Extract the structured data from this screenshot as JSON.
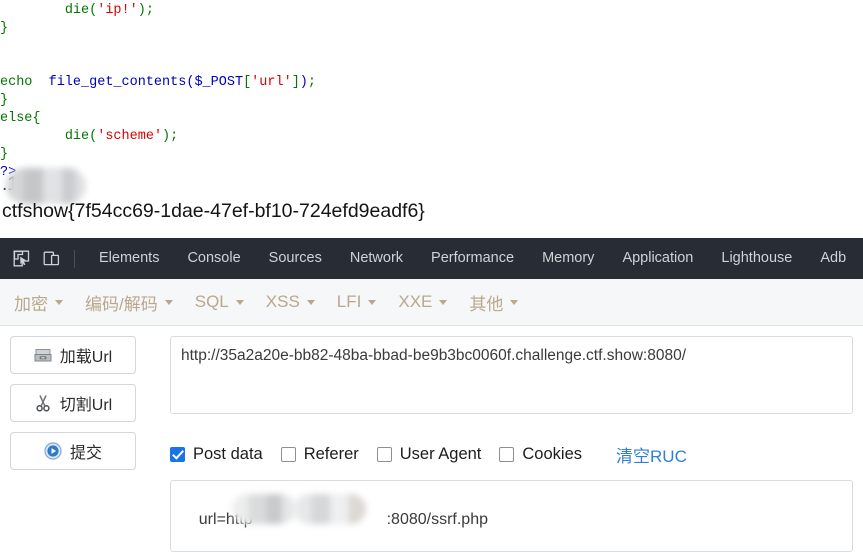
{
  "code_output": {
    "lines": [
      {
        "indent": 8,
        "tokens": [
          {
            "t": "die",
            "c": "kw"
          },
          {
            "t": "(",
            "c": "punc"
          },
          {
            "t": "'ip!'",
            "c": "str"
          },
          {
            "t": ")",
            "c": "punc"
          },
          {
            "t": ";",
            "c": "punc"
          }
        ]
      },
      {
        "indent": 0,
        "tokens": [
          {
            "t": "}",
            "c": "punc"
          }
        ]
      },
      {
        "indent": 0,
        "tokens": []
      },
      {
        "indent": 0,
        "tokens": []
      },
      {
        "indent": 0,
        "tokens": [
          {
            "t": "echo",
            "c": "kw"
          },
          {
            "t": "  ",
            "c": "plain"
          },
          {
            "t": "file_get_contents",
            "c": "fn"
          },
          {
            "t": "(",
            "c": "fn"
          },
          {
            "t": "$_POST",
            "c": "var"
          },
          {
            "t": "[",
            "c": "punc"
          },
          {
            "t": "'url'",
            "c": "str"
          },
          {
            "t": "]",
            "c": "punc"
          },
          {
            "t": ")",
            "c": "fn"
          },
          {
            "t": ";",
            "c": "punc"
          }
        ]
      },
      {
        "indent": 0,
        "tokens": [
          {
            "t": "}",
            "c": "punc"
          }
        ]
      },
      {
        "indent": 0,
        "tokens": [
          {
            "t": "else",
            "c": "kw"
          },
          {
            "t": "{",
            "c": "punc"
          }
        ]
      },
      {
        "indent": 8,
        "tokens": [
          {
            "t": "die",
            "c": "kw"
          },
          {
            "t": "(",
            "c": "punc"
          },
          {
            "t": "'scheme'",
            "c": "str"
          },
          {
            "t": ")",
            "c": "punc"
          },
          {
            "t": ";",
            "c": "punc"
          }
        ]
      },
      {
        "indent": 0,
        "tokens": [
          {
            "t": "}",
            "c": "punc"
          }
        ]
      },
      {
        "indent": 0,
        "tokens": [
          {
            "t": "?>",
            "c": "tag"
          }
        ]
      }
    ],
    "ip_line": ".141",
    "flag_line": "ctfshow{7f54cc69-1dae-47ef-bf10-724efd9eadf6}"
  },
  "devtools": {
    "inspect_icon": "inspect-element-icon",
    "device_icon": "device-toolbar-icon",
    "tabs": [
      {
        "label": "Elements"
      },
      {
        "label": "Console"
      },
      {
        "label": "Sources"
      },
      {
        "label": "Network"
      },
      {
        "label": "Performance"
      },
      {
        "label": "Memory"
      },
      {
        "label": "Application"
      },
      {
        "label": "Lighthouse"
      },
      {
        "label": "Adb"
      }
    ]
  },
  "tool_menubar": {
    "items": [
      {
        "label": "加密"
      },
      {
        "label": "编码/解码"
      },
      {
        "label": "SQL"
      },
      {
        "label": "XSS"
      },
      {
        "label": "LFI"
      },
      {
        "label": "XXE"
      },
      {
        "label": "其他"
      }
    ]
  },
  "workspace": {
    "buttons": [
      {
        "label": "加载Url",
        "icon": "load-url-icon"
      },
      {
        "label": "切割Url",
        "icon": "scissors-icon"
      },
      {
        "label": "提交",
        "icon": "play-circle-icon"
      }
    ],
    "url_field": {
      "value": "http://35a2a20e-bb82-48ba-bbad-be9b3bc0060f.challenge.ctf.show:8080/",
      "placeholder": ""
    },
    "options": [
      {
        "label": "Post data",
        "checked": true
      },
      {
        "label": "Referer",
        "checked": false
      },
      {
        "label": "User Agent",
        "checked": false
      },
      {
        "label": "Cookies",
        "checked": false
      }
    ],
    "clear_link": "清空RUC",
    "postdata_field": {
      "prefix": "url=http",
      "suffix": ":8080/ssrf.php",
      "placeholder": ""
    }
  },
  "colors": {
    "devtools_bar": "#282c34",
    "menubar_bg": "#f6f7f8",
    "menu_text": "#b9a88c",
    "accent_blue": "#1a73e8",
    "link_blue": "#2f7fd8",
    "code_keyword": "#007700",
    "code_function": "#0000bb",
    "code_string": "#dd0000"
  }
}
